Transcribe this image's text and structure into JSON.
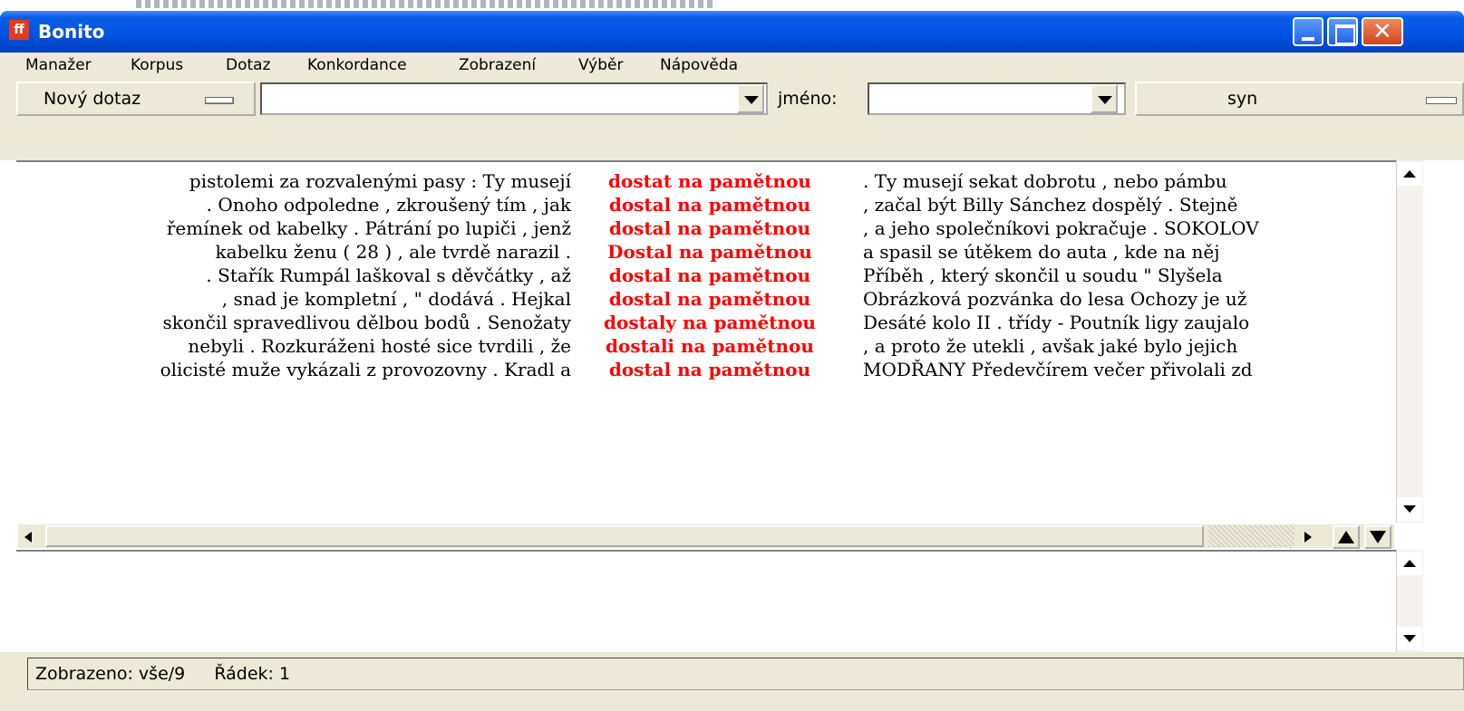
{
  "window": {
    "title": "Bonito",
    "app_icon": "bonito-logo-icon"
  },
  "menu": [
    "Manažer",
    "Korpus",
    "Dotaz",
    "Konkordance",
    "Zobrazení",
    "Výběr",
    "Nápověda"
  ],
  "toolbar": {
    "query_type": "Nový dotaz",
    "query_value": "",
    "name_label": "jméno:",
    "name_value": "",
    "corpus": "syn"
  },
  "concordance": [
    {
      "left": "pistolemi za rozvalenými pasy : Ty musejí",
      "kwic": "dostat na pamětnou",
      "right": ". Ty musejí sekat dobrotu , nebo pámbu"
    },
    {
      "left": ". Onoho odpoledne , zkroušený tím , jak",
      "kwic": "dostal na pamětnou",
      "right": ", začal být Billy Sánchez dospělý . Stejně"
    },
    {
      "left": "řemínek od kabelky . Pátrání po lupiči , jenž",
      "kwic": "dostal na pamětnou",
      "right": ", a jeho společníkovi pokračuje . SOKOLOV"
    },
    {
      "left": "kabelku ženu ( 28 ) , ale tvrdě narazil .",
      "kwic": "Dostal na pamětnou",
      "right": "a spasil se útěkem do auta , kde na něj"
    },
    {
      "left": ". Stařík Rumpál laškoval s děvčátky , až",
      "kwic": "dostal na pamětnou",
      "right": "Příběh , který skončil u soudu \" Slyšela"
    },
    {
      "left": ", snad je kompletní , \" dodává . Hejkal",
      "kwic": "dostal na pamětnou",
      "right": "Obrázková pozvánka do lesa Ochozy je už"
    },
    {
      "left": "skončil spravedlivou dělbou bodů . Senožaty",
      "kwic": "dostaly na pamětnou",
      "right": "Desáté kolo II . třídy - Poutník ligy zaujalo"
    },
    {
      "left": "nebyli . Rozkuráženi hosté sice tvrdili , že",
      "kwic": "dostali na pamětnou",
      "right": ", a proto že utekli , avšak jaké bylo jejich"
    },
    {
      "left": "olicisté muže vykázali z provozovny . Kradl a",
      "kwic": "dostal na pamětnou",
      "right": "MODŘANY Předevčírem večer přivolali zd"
    }
  ],
  "status": {
    "shown": "Zobrazeno: vše/9",
    "row": "Řádek: 1"
  },
  "colors": {
    "titlebar": "#0054e3",
    "keyword": "#ff0000",
    "chrome": "#ece9d8"
  }
}
